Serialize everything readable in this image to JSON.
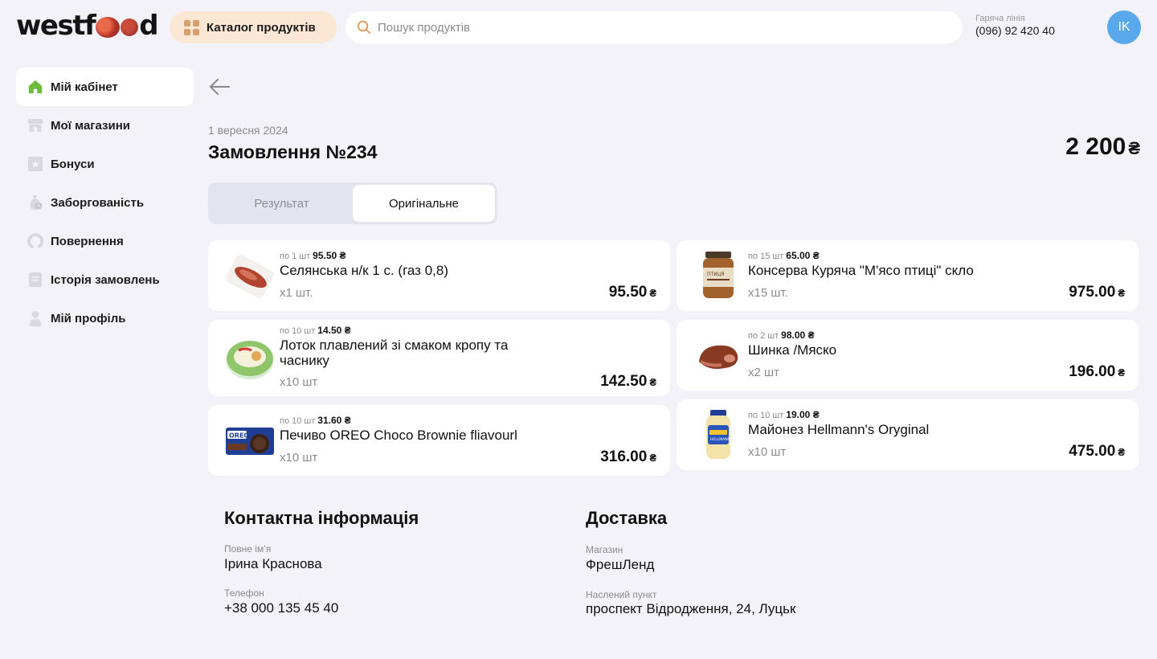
{
  "header": {
    "logo_text_left": "westf",
    "logo_text_right": "d",
    "catalog_label": "Каталог продуктів",
    "search_placeholder": "Пошук продуктів",
    "hotline_label": "Гаряча лінія",
    "hotline_number": "(096) 92 420 40",
    "avatar_initials": "IK"
  },
  "sidebar": {
    "items": [
      {
        "label": "Мій кабінет",
        "icon": "home-icon",
        "active": true
      },
      {
        "label": "Мої магазини",
        "icon": "store-icon"
      },
      {
        "label": "Бонуси",
        "icon": "bonus-icon"
      },
      {
        "label": "Заборгованість",
        "icon": "debt-icon"
      },
      {
        "label": "Повернення",
        "icon": "return-icon"
      },
      {
        "label": "Історія замовлень",
        "icon": "history-icon"
      },
      {
        "label": "Мій профіль",
        "icon": "profile-icon"
      }
    ]
  },
  "order": {
    "date": "1 вересня 2024",
    "title": "Замовлення №234",
    "total": "2 200",
    "currency": "₴",
    "tabs": [
      {
        "label": "Результат",
        "active": false
      },
      {
        "label": "Оригінальне",
        "active": true
      }
    ]
  },
  "items": [
    {
      "per_label": "по 1 шт",
      "per_price": "95.50 ₴",
      "name": "Селянська н/к 1 с. (газ 0,8)",
      "qty": "x1 шт.",
      "price": "95.50",
      "currency": "₴",
      "image": "sausage-image"
    },
    {
      "per_label": "по 10 шт",
      "per_price": "14.50 ₴",
      "name": "Лоток плавлений зі смаком кропу та часнику",
      "qty": "x10 шт",
      "price": "142.50",
      "currency": "₴",
      "image": "cheese-image"
    },
    {
      "per_label": "по 10 шт",
      "per_price": "31.60 ₴",
      "name": "Печиво OREO Choco Brownie fliavourl",
      "qty": "x10 шт",
      "price": "316.00",
      "currency": "₴",
      "image": "oreo-image"
    },
    {
      "per_label": "по 15 шт",
      "per_price": "65.00 ₴",
      "name": "Консерва Куряча \"М'ясо птиці\" скло",
      "qty": "x15 шт.",
      "price": "975.00",
      "currency": "₴",
      "image": "jar-image"
    },
    {
      "per_label": "по 2 шт",
      "per_price": "98.00 ₴",
      "name": "Шинка  /Мяско",
      "qty": "x2 шт",
      "price": "196.00",
      "currency": "₴",
      "image": "ham-image"
    },
    {
      "per_label": "по 10 шт",
      "per_price": "19.00 ₴",
      "name": "Майонез Hellmann's Oryginal",
      "qty": "x10 шт",
      "price": "475.00",
      "currency": "₴",
      "image": "mayo-image"
    }
  ],
  "contact": {
    "title": "Контактна інформація",
    "name_label": "Повне ім’я",
    "name_value": "Ірина Краснова",
    "phone_label": "Телефон",
    "phone_value": "+38 000 135 45 40"
  },
  "delivery": {
    "title": "Доставка",
    "store_label": "Магазин",
    "store_value": "ФрешЛенд",
    "locality_label": "Наслений пункт",
    "locality_value": "проспект Відродження, 24, Луцьк"
  },
  "colors": {
    "background": "#f2f2f8",
    "accent_catalog": "#fbe7d3",
    "avatar": "#5aa8ec",
    "active_home_icon": "#6dbb3c"
  }
}
